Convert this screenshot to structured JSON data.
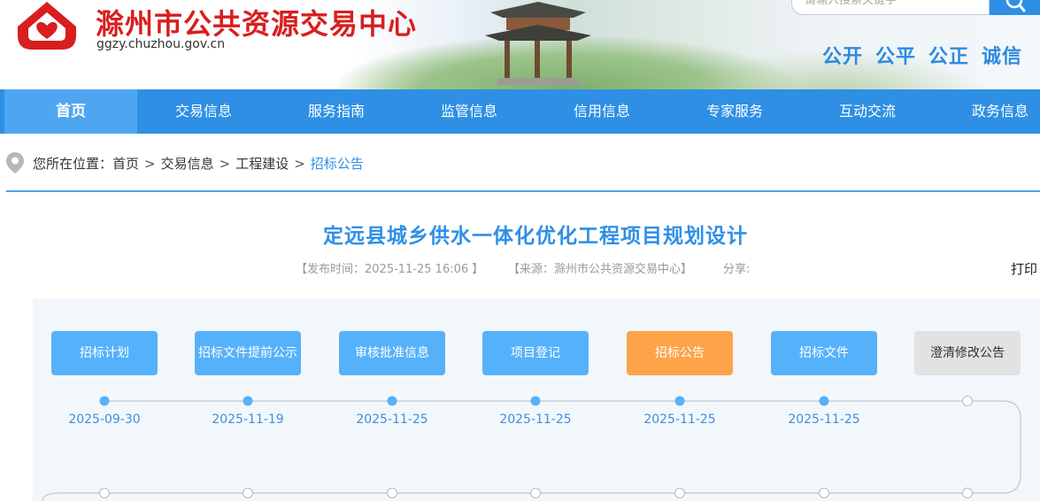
{
  "header": {
    "site_title": "滁州市公共资源交易中心",
    "site_url": "ggzy.chuzhou.gov.cn",
    "search_placeholder": "请输入搜索关键字",
    "slogan": [
      "公开",
      "公平",
      "公正",
      "诚信"
    ]
  },
  "nav": {
    "items": [
      "首页",
      "交易信息",
      "服务指南",
      "监管信息",
      "信用信息",
      "专家服务",
      "互动交流",
      "政务信息"
    ],
    "active_index": 0
  },
  "breadcrumb": {
    "prefix": "您所在位置：",
    "items": [
      "首页",
      "交易信息",
      "工程建设",
      "招标公告"
    ],
    "separator": ">"
  },
  "article": {
    "title": "定远县城乡供水一体化优化工程项目规划设计",
    "publish_time": "【发布时间：2025-11-25 16:06 】",
    "source": "【来源：滁州市公共资源交易中心】",
    "share_label": "分享:",
    "print_label": "打印"
  },
  "process": {
    "steps": [
      {
        "label": "招标计划",
        "date": "2025-09-30",
        "state": "done"
      },
      {
        "label": "招标文件提前公示",
        "date": "2025-11-19",
        "state": "done"
      },
      {
        "label": "审核批准信息",
        "date": "2025-11-25",
        "state": "done"
      },
      {
        "label": "项目登记",
        "date": "2025-11-25",
        "state": "done"
      },
      {
        "label": "招标公告",
        "date": "2025-11-25",
        "state": "current"
      },
      {
        "label": "招标文件",
        "date": "2025-11-25",
        "state": "done"
      },
      {
        "label": "澄清修改公告",
        "date": "",
        "state": "pending"
      }
    ]
  },
  "colors": {
    "primary": "#2e8fe4",
    "nav_active": "#4fa6f0",
    "title_red": "#d81e1e",
    "step_blue": "#56b1fb",
    "step_orange": "#fda34a",
    "step_gray": "#e2e2e2"
  }
}
